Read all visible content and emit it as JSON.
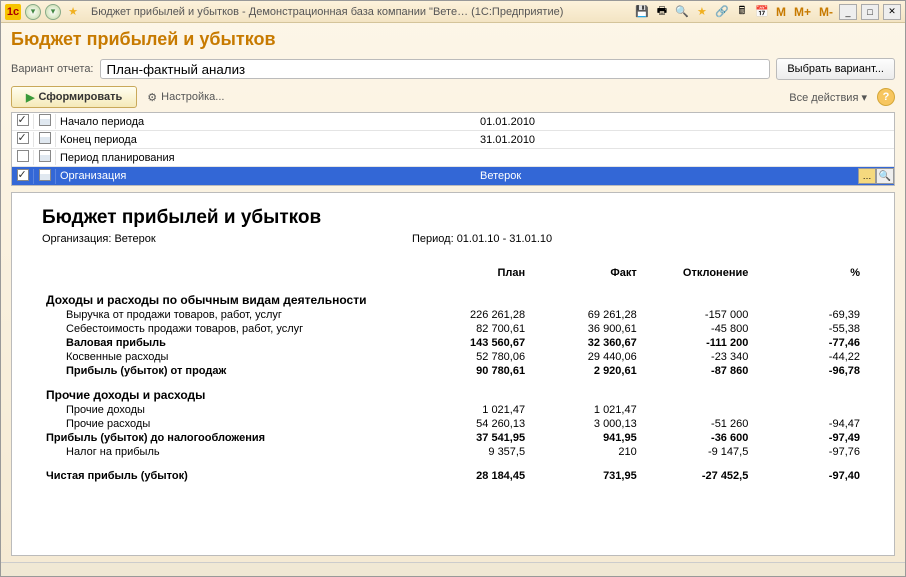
{
  "titlebar": {
    "title": "Бюджет прибылей и убытков - Демонстрационная база компании \"Вете…  (1С:Предприятие)"
  },
  "page": {
    "title": "Бюджет прибылей и убытков",
    "variant_label": "Вариант отчета:",
    "variant_value": "План-фактный анализ",
    "select_variant": "Выбрать вариант...",
    "form_btn": "Сформировать",
    "settings": "Настройка...",
    "all_actions": "Все действия"
  },
  "params": [
    {
      "checked": true,
      "label": "Начало периода",
      "value": "01.01.2010",
      "selected": false
    },
    {
      "checked": true,
      "label": "Конец периода",
      "value": "31.01.2010",
      "selected": false
    },
    {
      "checked": false,
      "label": "Период планирования",
      "value": "",
      "selected": false
    },
    {
      "checked": true,
      "label": "Организация",
      "value": "Ветерок",
      "selected": true
    }
  ],
  "report": {
    "title": "Бюджет прибылей и убытков",
    "org_label": "Организация: Ветерок",
    "period_label": "Период: 01.01.10 - 31.01.10",
    "headers": [
      "План",
      "Факт",
      "Отклонение",
      "%"
    ],
    "sections": [
      {
        "title": "Доходы и расходы по обычным видам деятельности",
        "rows": [
          {
            "label": "Выручка от продажи товаров, работ, услуг",
            "plan": "226 261,28",
            "fact": "69 261,28",
            "dev": "-157 000",
            "pct": "-69,39",
            "bold": false
          },
          {
            "label": "Себестоимость продажи товаров, работ, услуг",
            "plan": "82 700,61",
            "fact": "36 900,61",
            "dev": "-45 800",
            "pct": "-55,38",
            "bold": false
          },
          {
            "label": "Валовая прибыль",
            "plan": "143 560,67",
            "fact": "32 360,67",
            "dev": "-111 200",
            "pct": "-77,46",
            "bold": true
          },
          {
            "label": "Косвенные расходы",
            "plan": "52 780,06",
            "fact": "29 440,06",
            "dev": "-23 340",
            "pct": "-44,22",
            "bold": false
          },
          {
            "label": "Прибыль (убыток) от продаж",
            "plan": "90 780,61",
            "fact": "2 920,61",
            "dev": "-87 860",
            "pct": "-96,78",
            "bold": true
          }
        ]
      },
      {
        "title": "Прочие доходы и расходы",
        "rows": [
          {
            "label": "Прочие доходы",
            "plan": "1 021,47",
            "fact": "1 021,47",
            "dev": "",
            "pct": "",
            "bold": false
          },
          {
            "label": "Прочие расходы",
            "plan": "54 260,13",
            "fact": "3 000,13",
            "dev": "-51 260",
            "pct": "-94,47",
            "bold": false
          }
        ]
      }
    ],
    "totals": [
      {
        "label": "Прибыль (убыток) до налогообложения",
        "plan": "37 541,95",
        "fact": "941,95",
        "dev": "-36 600",
        "pct": "-97,49",
        "bold": true,
        "big": true
      },
      {
        "label": "Налог на прибыль",
        "plan": "9 357,5",
        "fact": "210",
        "dev": "-9 147,5",
        "pct": "-97,76",
        "bold": false,
        "ind": true
      },
      {
        "label": "Чистая прибыль (убыток)",
        "plan": "28 184,45",
        "fact": "731,95",
        "dev": "-27 452,5",
        "pct": "-97,40",
        "bold": true,
        "big": true,
        "gap": true
      }
    ]
  }
}
